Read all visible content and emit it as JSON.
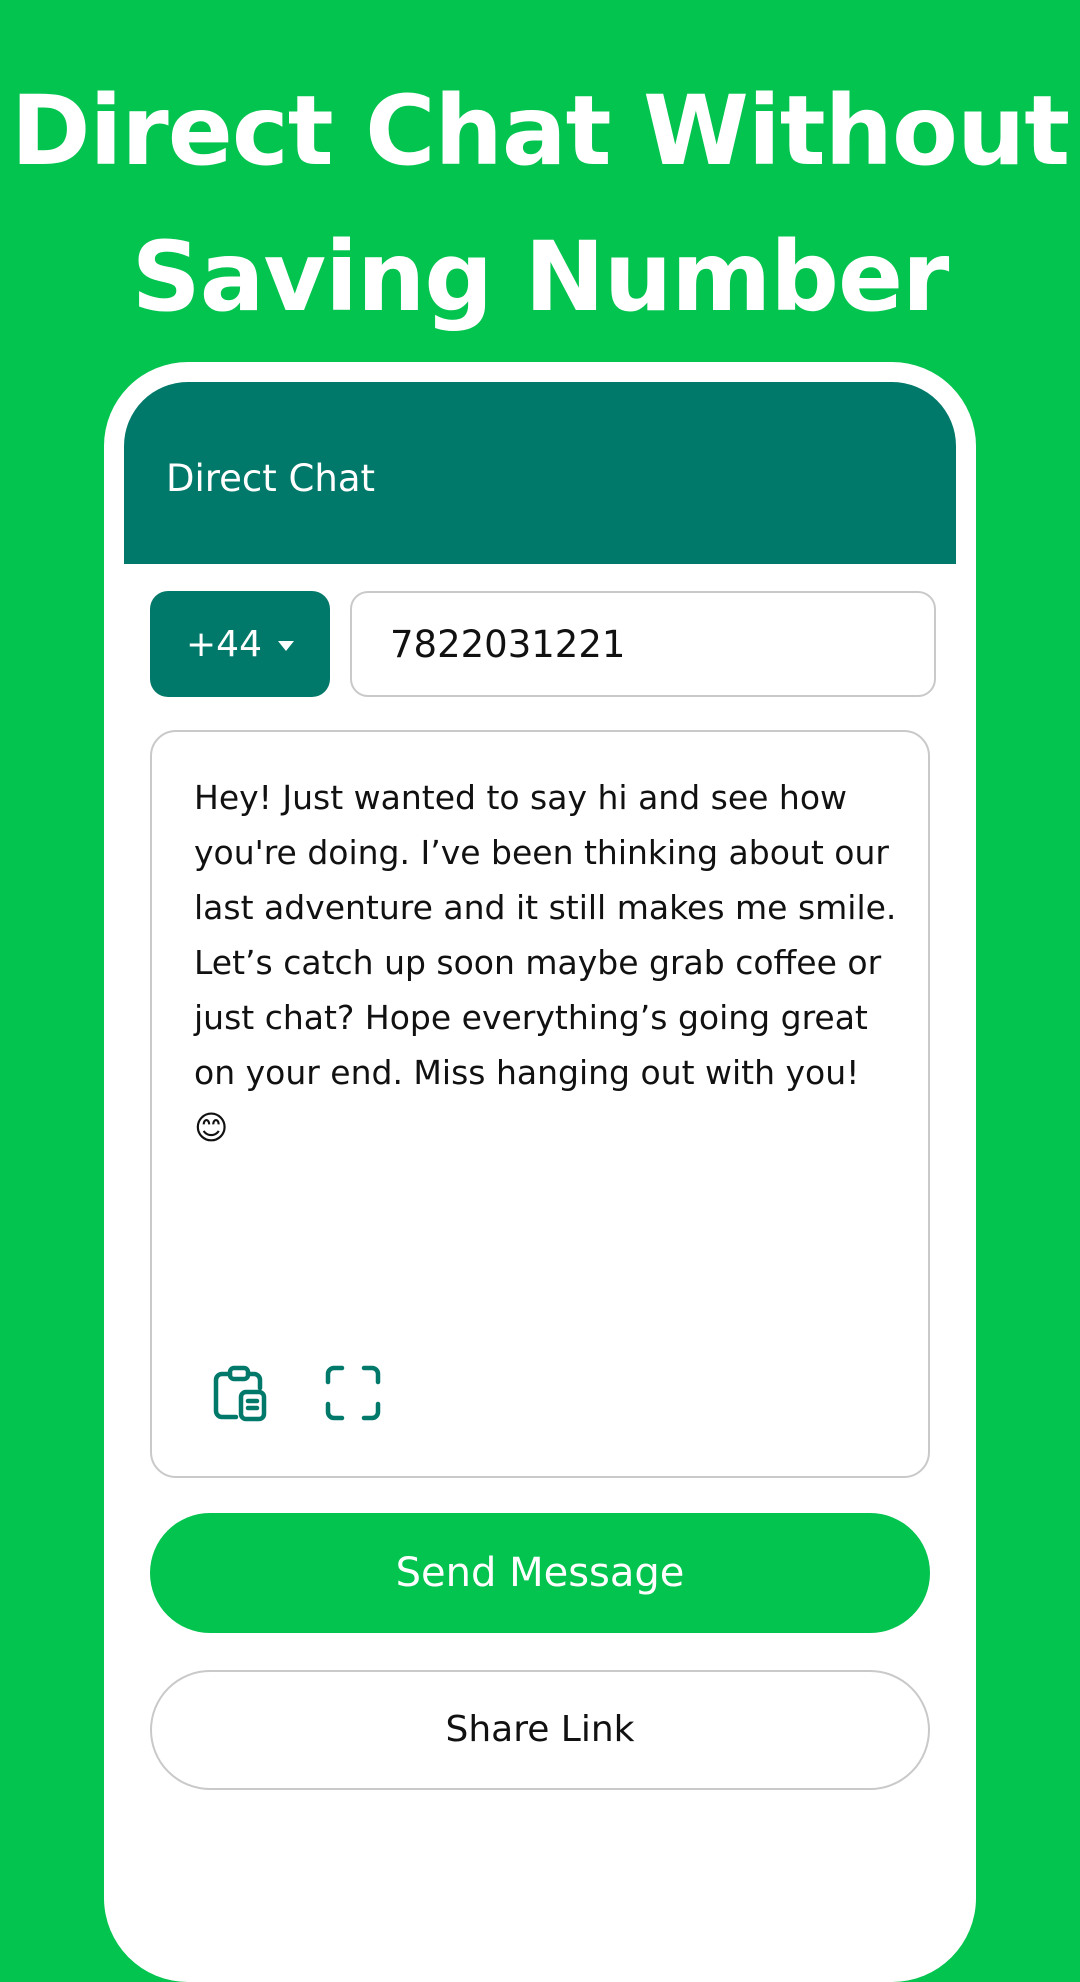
{
  "headline": {
    "line1": "Direct Chat Without",
    "line2": "Saving Number"
  },
  "appbar": {
    "title": "Direct Chat"
  },
  "form": {
    "country_code": "+44",
    "phone_number": "7822031221",
    "message": "Hey! Just wanted to say hi and see how you're doing. I’ve been thinking about our last adventure and it still makes me smile. Let’s catch up soon maybe grab coffee or just chat? Hope everything’s going great on your end. Miss hanging out with you! 😊"
  },
  "icons": {
    "paste": "clipboard-icon",
    "scan": "scan-frame-icon"
  },
  "buttons": {
    "send": "Send Message",
    "share": "Share Link"
  },
  "colors": {
    "background_green": "#03c44f",
    "brand_teal": "#01796a",
    "border_gray": "#c9c9c9"
  }
}
